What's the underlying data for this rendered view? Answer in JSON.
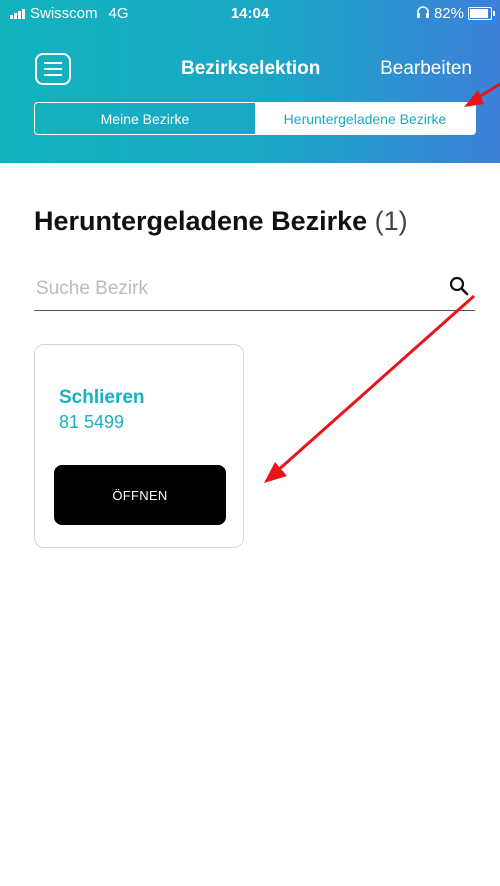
{
  "status": {
    "carrier": "Swisscom",
    "network": "4G",
    "time": "14:04",
    "battery": "82%"
  },
  "nav": {
    "title": "Bezirkselektion",
    "edit_label": "Bearbeiten"
  },
  "tabs": [
    {
      "label": "Meine Bezirke",
      "active": false
    },
    {
      "label": "Heruntergeladene Bezirke",
      "active": true
    }
  ],
  "content": {
    "heading": "Heruntergeladene Bezirke",
    "count": "(1)"
  },
  "search": {
    "placeholder": "Suche Bezirk",
    "value": ""
  },
  "districts": [
    {
      "name": "Schlieren",
      "code": "81 5499",
      "button_label": "ÖFFNEN"
    }
  ],
  "colors": {
    "accent": "#18b0c4",
    "header_gradient_start": "#12b3bd",
    "header_gradient_end": "#3d7fd9",
    "annotation_arrow": "#e8141b"
  },
  "icons": {
    "menu": "hamburger-menu-icon",
    "search": "search-icon",
    "signal": "signal-bars-icon",
    "headphones": "headphones-icon",
    "battery": "battery-icon"
  }
}
